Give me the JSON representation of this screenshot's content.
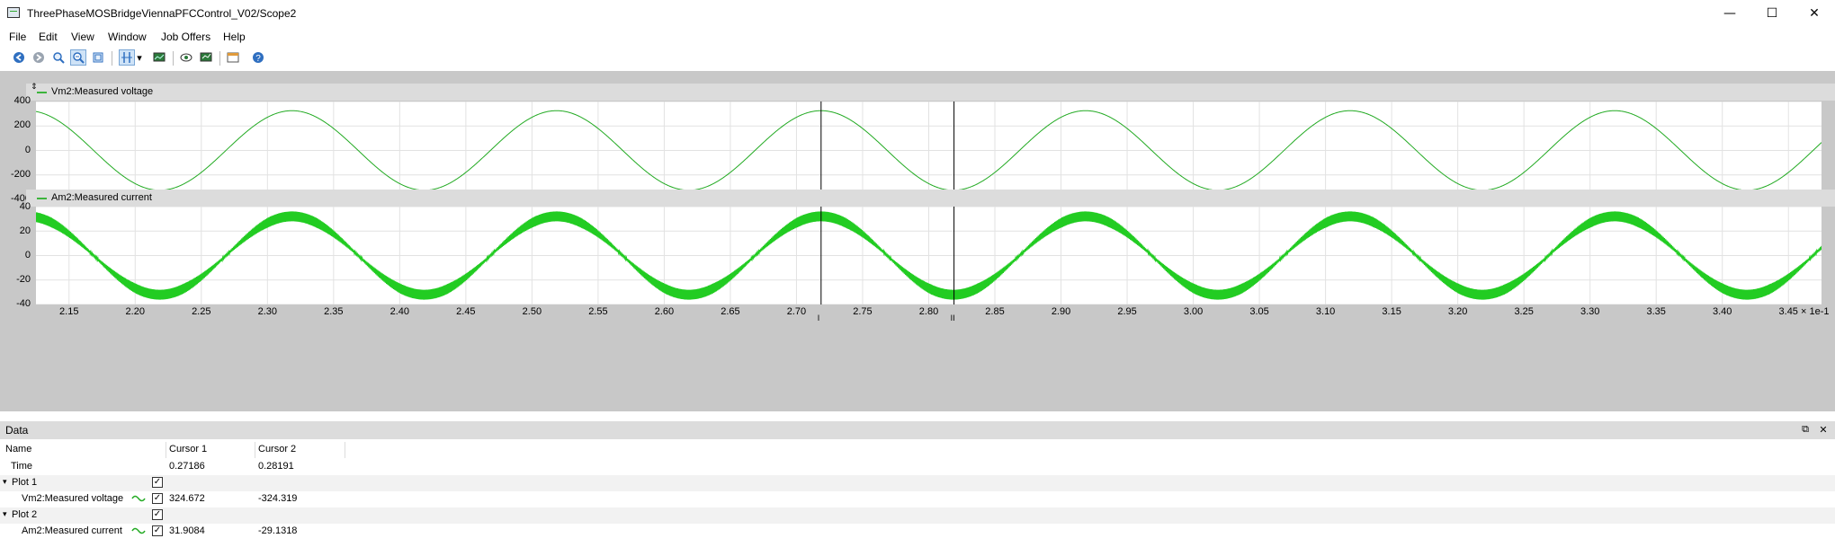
{
  "window": {
    "title": "ThreePhaseMOSBridgeViennaPFCControl_V02/Scope2",
    "minimize": "—",
    "maximize": "☐",
    "close": "✕"
  },
  "menu": [
    "File",
    "Edit",
    "View",
    "Window",
    "Job Offers",
    "Help"
  ],
  "toolbar": {
    "icons": [
      "back-icon",
      "forward-icon",
      "zoom-icon",
      "zoom-fit-icon",
      "zoom-box-icon",
      "cursor-icon",
      "dropdown-arrow-icon",
      "screen-icon",
      "eye-icon",
      "export-icon",
      "window-icon",
      "help-icon"
    ]
  },
  "plots": [
    {
      "legend": "Vm2:Measured voltage",
      "y_ticks": [
        "400",
        "200",
        "0",
        "-200",
        "-400"
      ]
    },
    {
      "legend": "Am2:Measured current",
      "y_ticks": [
        "40",
        "20",
        "0",
        "-20",
        "-40"
      ]
    }
  ],
  "x_ticks": [
    "2.15",
    "2.20",
    "2.25",
    "2.30",
    "2.35",
    "2.40",
    "2.45",
    "2.50",
    "2.55",
    "2.60",
    "2.65",
    "2.70",
    "2.75",
    "2.80",
    "2.85",
    "2.90",
    "2.95",
    "3.00",
    "3.05",
    "3.10",
    "3.15",
    "3.20",
    "3.25",
    "3.30",
    "3.35",
    "3.40",
    "3.45"
  ],
  "x_multiplier": "× 1e-1",
  "cursors": {
    "c1_label": "I",
    "c2_label": "II"
  },
  "chart_data": [
    {
      "type": "line",
      "series": [
        {
          "name": "Vm2:Measured voltage",
          "color": "#22aa22",
          "amplitude": 325,
          "frequency_hz": 50
        }
      ],
      "xlim": [
        0.2125,
        0.3475
      ],
      "ylim": [
        -400,
        400
      ],
      "grid": true
    },
    {
      "type": "line",
      "series": [
        {
          "name": "Am2:Measured current",
          "color": "#22cc22",
          "amplitude": 32,
          "frequency_hz": 50,
          "ripple": 4
        }
      ],
      "xlim": [
        0.2125,
        0.3475
      ],
      "ylim": [
        -40,
        40
      ],
      "grid": true
    }
  ],
  "data_panel": {
    "title": "Data",
    "restore": "⧉",
    "close": "✕",
    "columns": [
      "Name",
      "Cursor 1",
      "Cursor 2"
    ],
    "time_row": {
      "name": "Time",
      "c1": "0.27186",
      "c2": "0.28191"
    },
    "groups": [
      {
        "name": "Plot 1",
        "signal": "Vm2:Measured voltage",
        "c1": "324.672",
        "c2": "-324.319"
      },
      {
        "name": "Plot 2",
        "signal": "Am2:Measured current",
        "c1": "31.9084",
        "c2": "-29.1318"
      }
    ]
  }
}
